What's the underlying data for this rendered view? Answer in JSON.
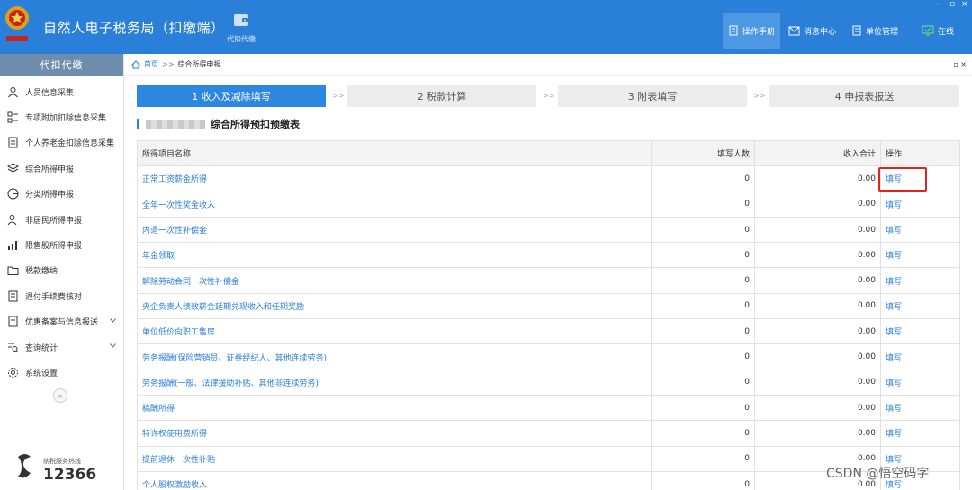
{
  "header": {
    "app_title": "自然人电子税务局（扣缴端）",
    "module_label": "代扣代缴",
    "items": [
      {
        "label": "操作手册",
        "icon": "manual-icon"
      },
      {
        "label": "消息中心",
        "icon": "mail-icon"
      },
      {
        "label": "单位管理",
        "icon": "building-icon"
      },
      {
        "label": "在线",
        "icon": "monitor-icon"
      }
    ]
  },
  "sidebar": {
    "title": "代扣代缴",
    "items": [
      {
        "label": "人员信息采集",
        "icon": "person-icon"
      },
      {
        "label": "专项附加扣除信息采集",
        "icon": "list-icon"
      },
      {
        "label": "个人养老金扣除信息采集",
        "icon": "document-icon"
      },
      {
        "label": "综合所得申报",
        "icon": "layers-icon"
      },
      {
        "label": "分类所得申报",
        "icon": "pie-icon"
      },
      {
        "label": "非居民所得申报",
        "icon": "user-search-icon"
      },
      {
        "label": "限售股所得申报",
        "icon": "bar-chart-icon"
      },
      {
        "label": "税款缴纳",
        "icon": "folder-icon"
      },
      {
        "label": "退付手续费核对",
        "icon": "receipt-icon"
      },
      {
        "label": "优惠备案与信息报送",
        "icon": "document-icon"
      },
      {
        "label": "查询统计",
        "icon": "query-icon"
      },
      {
        "label": "系统设置",
        "icon": "gear-icon"
      }
    ],
    "collapse_label": "«",
    "hotline_label": "纳税服务热线",
    "hotline_number": "12366"
  },
  "breadcrumb": {
    "home": "首页",
    "separator": ">>",
    "current": "综合所得申报"
  },
  "steps": [
    {
      "label": "1 收入及减除填写",
      "active": true
    },
    {
      "label": "2 税款计算",
      "active": false
    },
    {
      "label": "3 附表填写",
      "active": false
    },
    {
      "label": "4 申报表报送",
      "active": false
    }
  ],
  "step_separator": ">>",
  "section": {
    "title": "综合所得预扣预缴表"
  },
  "table": {
    "headers": [
      "所得项目名称",
      "填写人数",
      "收入合计",
      "操作"
    ],
    "rows": [
      {
        "name": "正常工资薪金所得",
        "count": "0",
        "income": "0.00",
        "op": "填写"
      },
      {
        "name": "全年一次性奖金收入",
        "count": "0",
        "income": "0.00",
        "op": "填写"
      },
      {
        "name": "内退一次性补偿金",
        "count": "0",
        "income": "0.00",
        "op": "填写"
      },
      {
        "name": "年金领取",
        "count": "0",
        "income": "0.00",
        "op": "填写"
      },
      {
        "name": "解除劳动合同一次性补偿金",
        "count": "0",
        "income": "0.00",
        "op": "填写"
      },
      {
        "name": "央企负责人绩效薪金延期兑现收入和任期奖励",
        "count": "0",
        "income": "0.00",
        "op": "填写"
      },
      {
        "name": "单位低价向职工售房",
        "count": "0",
        "income": "0.00",
        "op": "填写"
      },
      {
        "name": "劳务报酬(保险营销员、证券经纪人、其他连续劳务)",
        "count": "0",
        "income": "0.00",
        "op": "填写"
      },
      {
        "name": "劳务报酬(一般、法律援助补贴、其他非连续劳务)",
        "count": "0",
        "income": "0.00",
        "op": "填写"
      },
      {
        "name": "稿酬所得",
        "count": "0",
        "income": "0.00",
        "op": "填写"
      },
      {
        "name": "特许权使用费所得",
        "count": "0",
        "income": "0.00",
        "op": "填写"
      },
      {
        "name": "提前退休一次性补贴",
        "count": "0",
        "income": "0.00",
        "op": "填写"
      },
      {
        "name": "个人股权激励收入",
        "count": "0",
        "income": "0.00",
        "op": "填写"
      }
    ]
  },
  "watermark": "CSDN @悟空码字",
  "colors": {
    "header": "#2a7fd8",
    "active_step": "#2d87e0",
    "link": "#2a7fd8",
    "highlight": "#e02222"
  }
}
